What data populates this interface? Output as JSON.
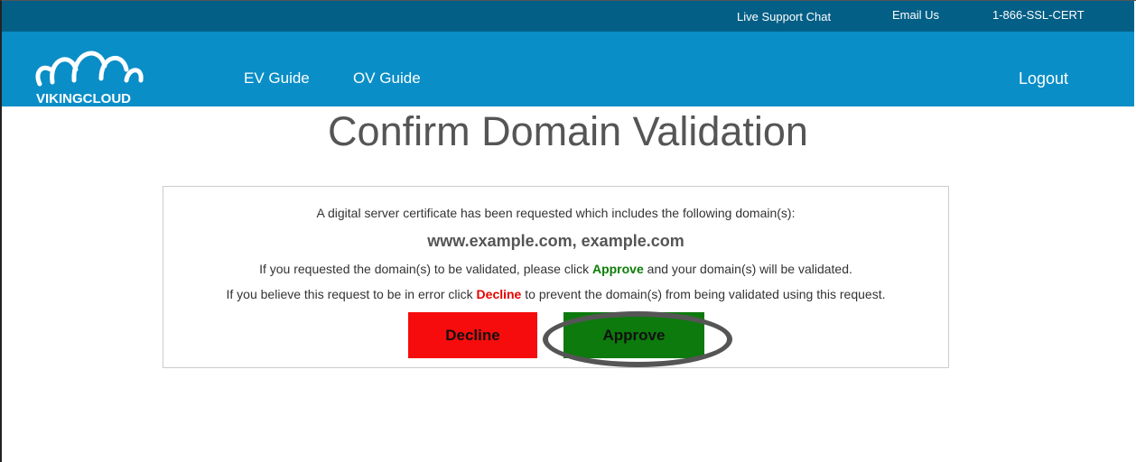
{
  "topbar": {
    "live_chat": "Live Support Chat",
    "email": "Email Us",
    "phone": "1-866-SSL-CERT"
  },
  "nav": {
    "logo_text": "VIKINGCLOUD",
    "ev_guide": "EV Guide",
    "ov_guide": "OV Guide",
    "logout": "Logout"
  },
  "page": {
    "title": "Confirm Domain Validation"
  },
  "panel": {
    "intro": "A digital server certificate has been requested which includes the following domain(s):",
    "domains": "www.example.com, example.com",
    "approve_text_before": "If you requested the domain(s) to be validated, please click ",
    "approve_keyword": "Approve",
    "approve_text_after": " and your domain(s) will be validated.",
    "decline_text_before": "If you believe this request to be in error click ",
    "decline_keyword": "Decline",
    "decline_text_after": " to prevent the domain(s) from being validated using this request.",
    "decline_button": "Decline",
    "approve_button": "Approve"
  },
  "colors": {
    "topbar": "#045f86",
    "navbar": "#0a8ec7",
    "decline": "#f60c0c",
    "approve": "#0c7a0c"
  }
}
